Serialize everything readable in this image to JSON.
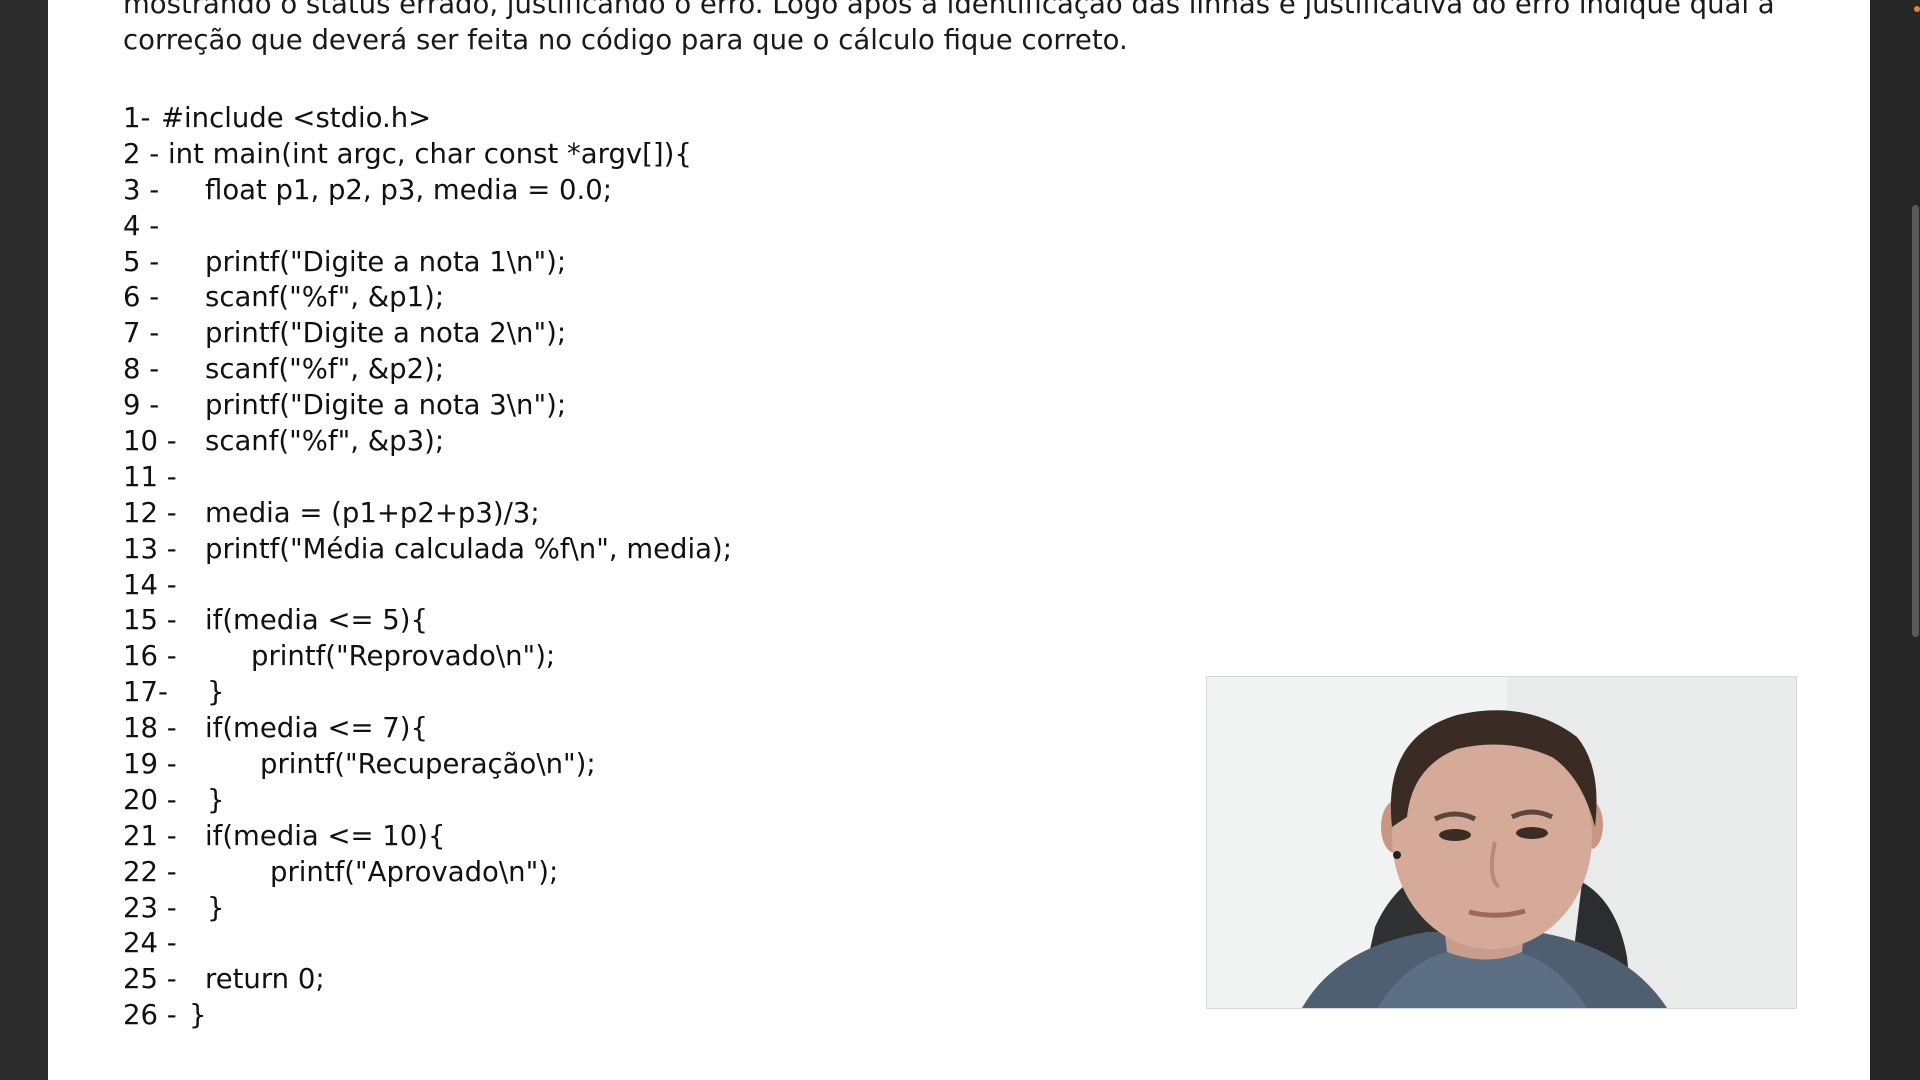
{
  "document": {
    "intro_lines": [
      "mostrando o status errado, justificando o erro. Logo após a identificação das linhas e justificativa do erro indique qual a",
      "correção que deverá ser feita no código para que o cálculo fique correto."
    ],
    "code_lines": [
      {
        "num": "1-",
        "code": "#include <stdio.h>"
      },
      {
        "num": "2 -",
        "code": "int main(int argc, char const *argv[]){"
      },
      {
        "num": "3 -",
        "code": "float p1, p2, p3, media = 0.0;"
      },
      {
        "num": "4 -",
        "code": ""
      },
      {
        "num": "5 -",
        "code": "printf(\"Digite a nota 1\\n\");"
      },
      {
        "num": "6 -",
        "code": "scanf(\"%f\", &p1);"
      },
      {
        "num": "7 -",
        "code": "printf(\"Digite a nota 2\\n\");"
      },
      {
        "num": "8 -",
        "code": "scanf(\"%f\", &p2);"
      },
      {
        "num": "9 -",
        "code": "printf(\"Digite a nota 3\\n\");"
      },
      {
        "num": "10 -",
        "code": "scanf(\"%f\", &p3);"
      },
      {
        "num": "11 -",
        "code": ""
      },
      {
        "num": "12 -",
        "code": "media = (p1+p2+p3)/3;"
      },
      {
        "num": "13 -",
        "code": "printf(\"Média calculada %f\\n\", media);"
      },
      {
        "num": "14 -",
        "code": ""
      },
      {
        "num": "15 -",
        "code": "if(media <= 5){"
      },
      {
        "num": "16 -",
        "code": "printf(\"Reprovado\\n\");"
      },
      {
        "num": "17-",
        "code": "}"
      },
      {
        "num": "18 -",
        "code": "if(media <= 7){"
      },
      {
        "num": "19 -",
        "code": "printf(\"Recuperação\\n\");"
      },
      {
        "num": "20 -",
        "code": "}"
      },
      {
        "num": "21 -",
        "code": "if(media <= 10){"
      },
      {
        "num": "22 -",
        "code": "printf(\"Aprovado\\n\");"
      },
      {
        "num": "23 -",
        "code": "}"
      },
      {
        "num": "24 -",
        "code": ""
      },
      {
        "num": "25 -",
        "code": "return 0;"
      },
      {
        "num": "26 -",
        "code": "}"
      }
    ]
  },
  "webcam": {
    "icon": "person-webcam-icon"
  },
  "colors": {
    "page_background": "#ffffff",
    "outer_background": "#2b2b2b",
    "text": "#111111"
  }
}
